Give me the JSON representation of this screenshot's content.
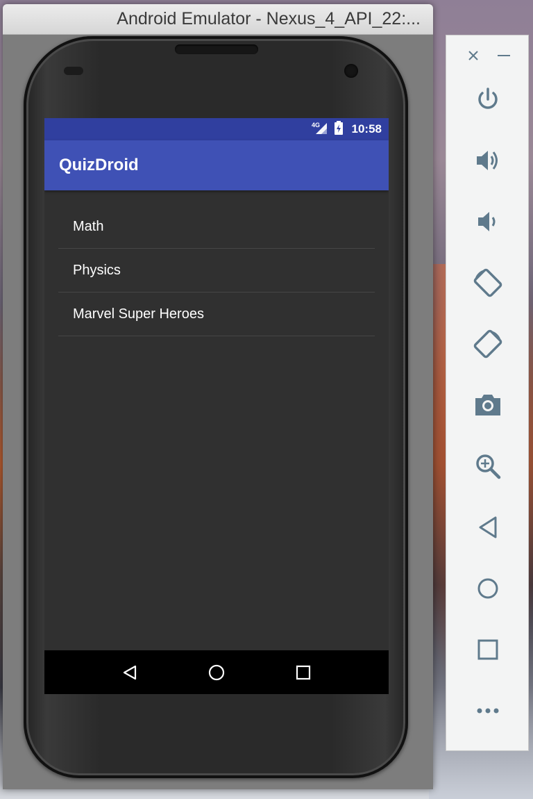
{
  "window": {
    "title": "Android Emulator - Nexus_4_API_22:..."
  },
  "status_bar": {
    "network": "4G",
    "time": "10:58"
  },
  "app": {
    "title": "QuizDroid",
    "topics": [
      "Math",
      "Physics",
      "Marvel Super Heroes"
    ]
  },
  "nav_bar": {
    "icons": [
      "back-triangle",
      "home-circle",
      "recents-square"
    ]
  },
  "toolbar": {
    "icons": [
      "close",
      "minimize",
      "power",
      "volume-up",
      "volume-down",
      "rotate-left",
      "rotate-right",
      "camera",
      "zoom",
      "back",
      "home",
      "overview",
      "more"
    ]
  },
  "colors": {
    "status_bar": "#303f9f",
    "app_bar": "#3f51b5",
    "screen_bg": "#303030",
    "toolbar_icon": "#5f7a8c"
  }
}
